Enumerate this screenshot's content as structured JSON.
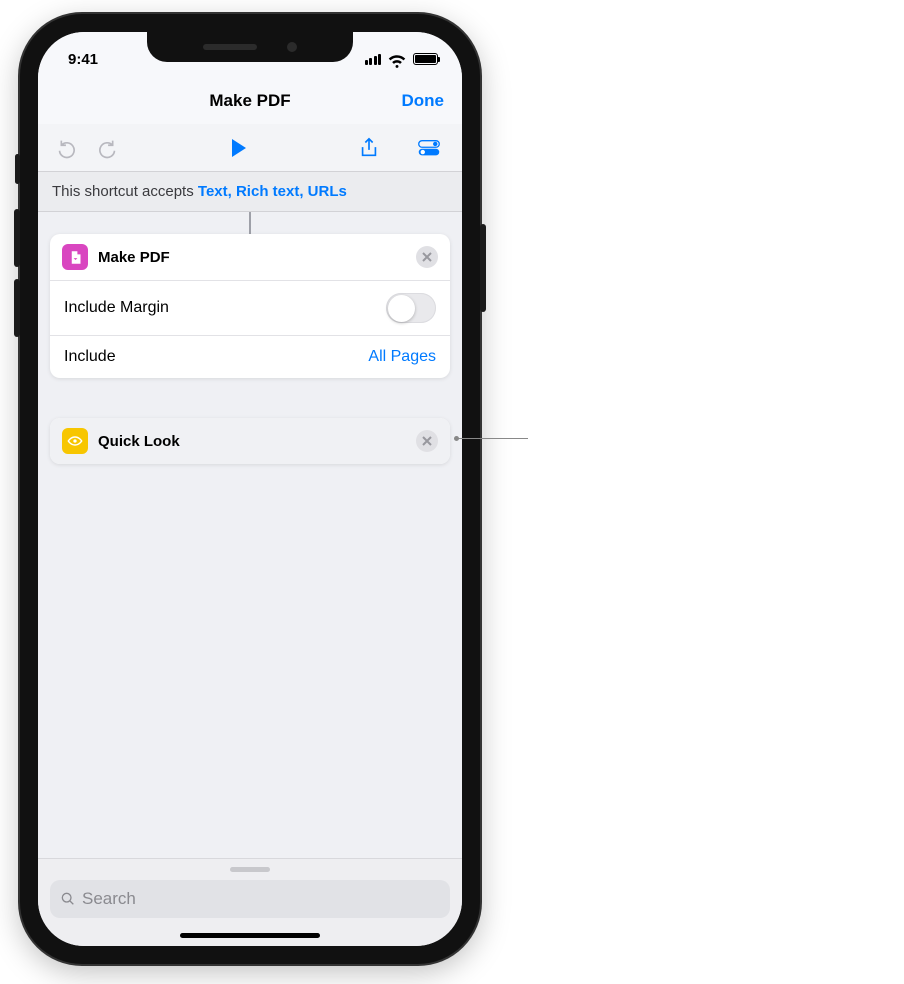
{
  "status": {
    "time": "9:41"
  },
  "nav": {
    "title": "Make PDF",
    "done": "Done"
  },
  "accepts": {
    "prefix": "This shortcut accepts ",
    "types": "Text, Rich text, URLs"
  },
  "actions": {
    "makepdf": {
      "title": "Make PDF",
      "include_margin_label": "Include Margin",
      "include_label": "Include",
      "include_value": "All Pages"
    },
    "quicklook": {
      "title": "Quick Look"
    }
  },
  "search": {
    "placeholder": "Search"
  }
}
